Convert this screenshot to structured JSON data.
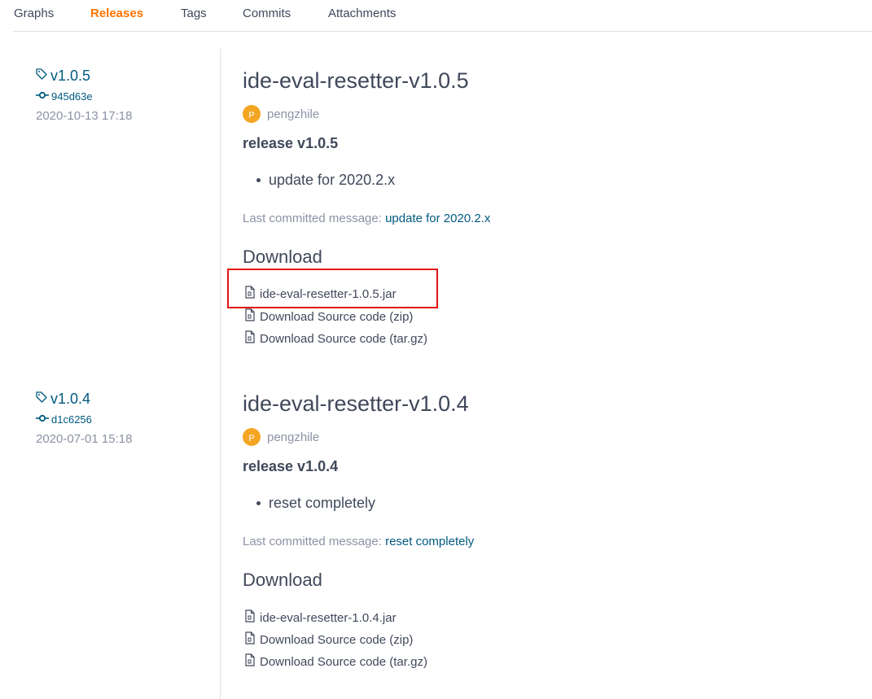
{
  "tabs": [
    {
      "label": "Graphs",
      "active": false
    },
    {
      "label": "Releases",
      "active": true
    },
    {
      "label": "Tags",
      "active": false
    },
    {
      "label": "Commits",
      "active": false
    },
    {
      "label": "Attachments",
      "active": false
    }
  ],
  "colors": {
    "accent": "#fe7300",
    "link": "#005980",
    "text": "#40485b",
    "muted": "#8c92a4",
    "highlight": "#e31414",
    "avatar": "#f4a623"
  },
  "releases": [
    {
      "tag": "v1.0.5",
      "commit": "945d63e",
      "date": "2020-10-13 17:18",
      "title": "ide-eval-resetter-v1.0.5",
      "author_initial": "P",
      "author": "pengzhile",
      "name": "release v1.0.5",
      "notes": [
        "update for 2020.2.x"
      ],
      "commit_label": "Last committed message: ",
      "commit_message": "update for 2020.2.x",
      "download_heading": "Download",
      "downloads": [
        "ide-eval-resetter-1.0.5.jar",
        "Download Source code (zip)",
        "Download Source code (tar.gz)"
      ]
    },
    {
      "tag": "v1.0.4",
      "commit": "d1c6256",
      "date": "2020-07-01 15:18",
      "title": "ide-eval-resetter-v1.0.4",
      "author_initial": "P",
      "author": "pengzhile",
      "name": "release v1.0.4",
      "notes": [
        "reset completely"
      ],
      "commit_label": "Last committed message: ",
      "commit_message": "reset completely",
      "download_heading": "Download",
      "downloads": [
        "ide-eval-resetter-1.0.4.jar",
        "Download Source code (zip)",
        "Download Source code (tar.gz)"
      ]
    }
  ],
  "icons": {
    "tag": "tag-icon",
    "commit": "commit-icon",
    "file": "file-archive-icon"
  }
}
